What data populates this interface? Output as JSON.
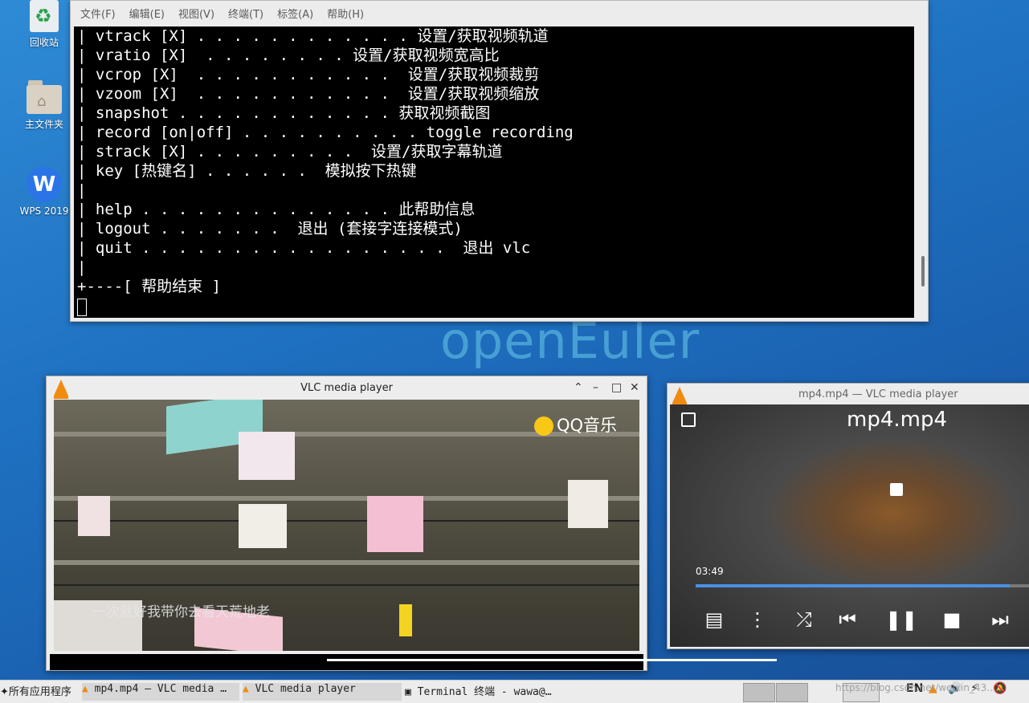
{
  "desktop": {
    "brand": "openEuler",
    "icons": [
      {
        "label": "回收站"
      },
      {
        "label": "主文件夹"
      },
      {
        "label": "WPS 2019"
      }
    ]
  },
  "terminal": {
    "menu": [
      "文件(F)",
      "编辑(E)",
      "视图(V)",
      "终端(T)",
      "标签(A)",
      "帮助(H)"
    ],
    "text": "| vtrack [X] . . . . . . . . . . . . 设置/获取视频轨道\n| vratio [X]  . . . . . . . . 设置/获取视频宽高比\n| vcrop [X]  . . . . . . . . . . .  设置/获取视频裁剪\n| vzoom [X]  . . . . . . . . . . .  设置/获取视频缩放\n| snapshot . . . . . . . . . . . . 获取视频截图\n| record [on|off] . . . . . . . . . . toggle recording\n| strack [X] . . . . . . . . .  设置/获取字幕轨道\n| key [热键名] . . . . . .  模拟按下热键\n|\n| help . . . . . . . . . . . . . . 此帮助信息\n| logout . . . . . . .  退出 (套接字连接模式)\n| quit . . . . . . . . . . . . . . . . .  退出 vlc\n|\n+----[ 帮助结束 ]"
  },
  "vlc_main": {
    "title": "VLC media player",
    "watermark": "QQ音乐",
    "subtitle": "一次就好我带你去看天荒地老"
  },
  "vlc_fullscreen": {
    "title": "mp4.mp4 — VLC media player",
    "filename": "mp4.mp4",
    "time": "03:49",
    "progress_fraction": 0.93
  },
  "taskbar": {
    "start_label": "所有应用程序",
    "tasks": [
      {
        "label": "mp4.mp4 — VLC media …"
      },
      {
        "label": "VLC media player"
      },
      {
        "label": "Terminal 终端 - wawa@…"
      }
    ],
    "lang": "EN",
    "url_watermark": "https://blog.csdn.net/weixin_43…"
  }
}
